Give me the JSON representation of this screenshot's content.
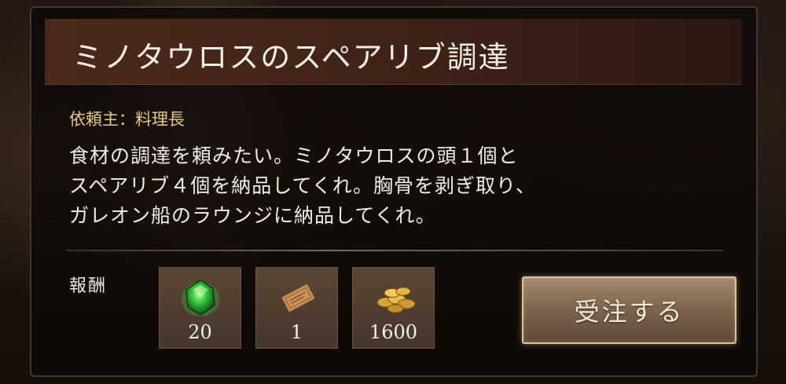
{
  "quest": {
    "title": "ミノタウロスのスペアリブ調達",
    "client_label": "依頼主：",
    "client_name": "料理長",
    "description": [
      "食材の調達を頼みたい。ミノタウロスの頭１個と",
      "スペアリブ４個を納品してくれ。胸骨を剥ぎ取り、",
      "ガレオン船のラウンジに納品してくれ。"
    ]
  },
  "rewards": {
    "label": "報酬",
    "items": [
      {
        "icon": "green-gem-icon",
        "count": "20"
      },
      {
        "icon": "ticket-icon",
        "count": "1"
      },
      {
        "icon": "gold-coins-icon",
        "count": "1600"
      }
    ]
  },
  "actions": {
    "accept_label": "受注する"
  },
  "colors": {
    "title_bar": "#4b2a1c",
    "client_text": "#e6c98a",
    "button_border": "#d8c39c"
  }
}
